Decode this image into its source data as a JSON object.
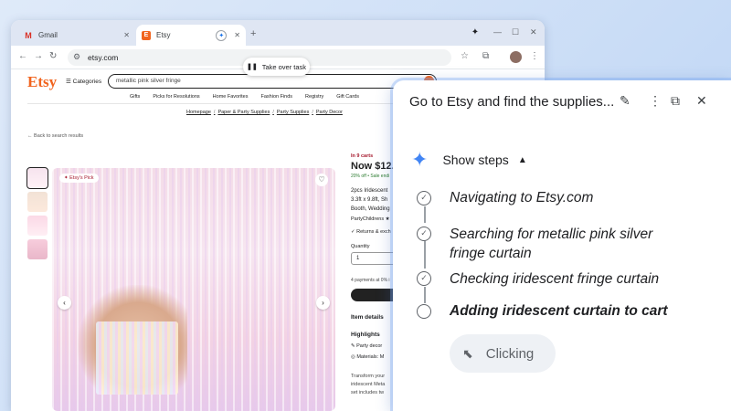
{
  "browser": {
    "tabs": [
      {
        "title": "Gmail",
        "icon": "gmail-icon"
      },
      {
        "title": "Etsy",
        "icon": "etsy-favicon"
      }
    ],
    "url": "etsy.com",
    "take_over_label": "Take over task"
  },
  "etsy": {
    "logo": "Etsy",
    "categories_label": "Categories",
    "search_value": "metallic pink silver fringe",
    "nav": [
      "Gifts",
      "Picks for Resolutions",
      "Home Favorites",
      "Fashion Finds",
      "Registry",
      "Gift Cards"
    ],
    "breadcrumbs": [
      "Homepage",
      "Paper & Party Supplies",
      "Party Supplies",
      "Party Decor"
    ],
    "back_link": "Back to search results",
    "badge": "Etsy's Pick",
    "in_carts": "In 9 carts",
    "price": "Now $12.8",
    "sale": "20% off • Sale endi",
    "description": [
      "2pcs Iridescent",
      "3.3ft x 9.8ft, Sh",
      "Booth, Wedding"
    ],
    "shop": "PartyChildrens ★",
    "returns": "Returns & exch",
    "quantity_label": "Quantity",
    "quantity_value": "1",
    "payments": "4 payments at 0% i",
    "item_details": "Item details",
    "highlights": "Highlights",
    "highlight_items": [
      "Party decor",
      "Materials: M"
    ],
    "transform": [
      "Transform your",
      "iridescent Meta",
      "set includes tw"
    ]
  },
  "panel": {
    "title": "Go to Etsy and find the supplies...",
    "show_steps": "Show steps",
    "steps": [
      {
        "text": "Navigating to Etsy.com",
        "done": true
      },
      {
        "text": "Searching for metallic pink silver fringe curtain",
        "done": true
      },
      {
        "text": "Checking iridescent fringe curtain",
        "done": true
      },
      {
        "text": "Adding iridescent curtain to cart",
        "done": false
      }
    ],
    "status": "Clicking"
  }
}
